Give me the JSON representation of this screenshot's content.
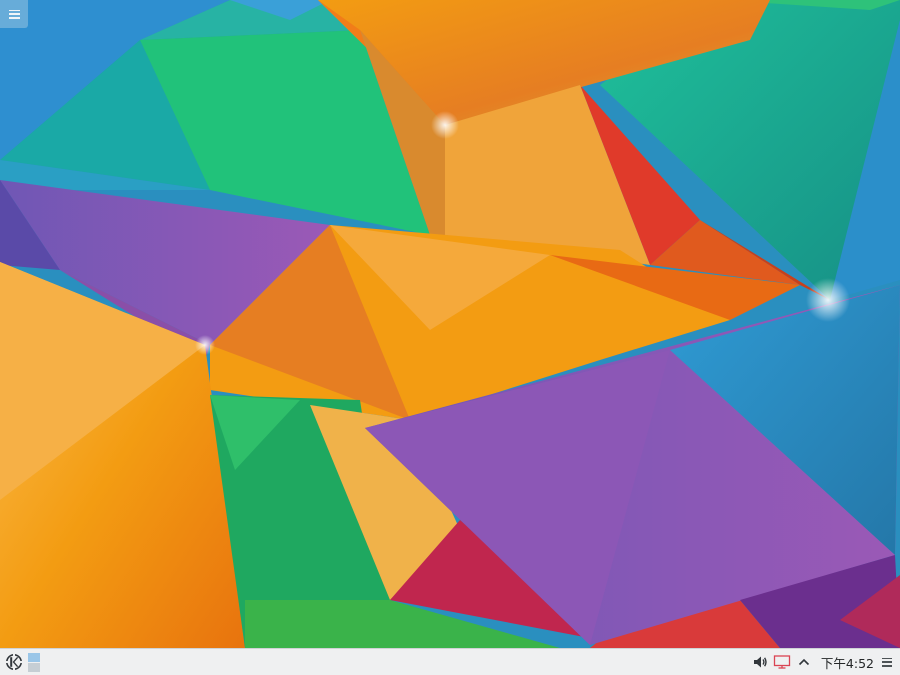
{
  "desktop": {
    "wallpaper_name": "kde-plasma-geometric-wallpaper",
    "toolbox_icon": "hamburger-menu-icon"
  },
  "taskbar": {
    "launcher_icon": "kde-logo-icon",
    "pager": {
      "desktops": 2,
      "active_desktop": 1
    },
    "tray": {
      "volume_icon": "volume-icon",
      "display_icon": "display-icon",
      "expand_icon": "chevron-up-icon"
    },
    "clock": {
      "time": "下午4:52"
    },
    "panel_toolbox_icon": "hamburger-menu-icon"
  },
  "colors": {
    "panel_background": "#eff0f1",
    "panel_text": "#232627",
    "pager_active": "#9ac6e8",
    "pager_inactive": "#c6ced4"
  }
}
